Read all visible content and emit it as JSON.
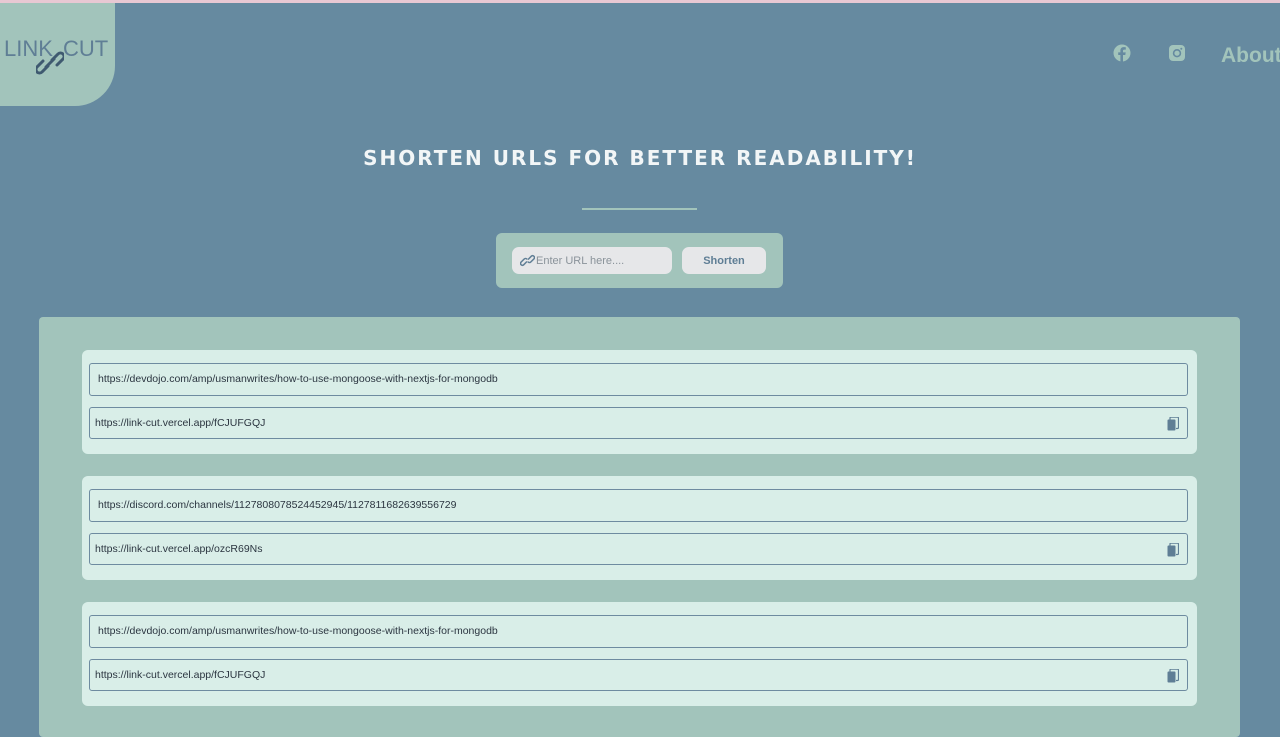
{
  "logo": {
    "left_text": "LINK",
    "right_text": "CUT"
  },
  "nav": {
    "facebook_icon": "facebook-icon",
    "instagram_icon": "instagram-icon",
    "about_label": "About"
  },
  "hero": {
    "headline": "SHORTEN URLS FOR BETTER READABILITY!"
  },
  "shortener": {
    "placeholder": "Enter URL here....",
    "input_value": "",
    "button_label": "Shorten"
  },
  "results": [
    {
      "original": "https://devdojo.com/amp/usmanwrites/how-to-use-mongoose-with-nextjs-for-mongodb",
      "short": "https://link-cut.vercel.app/fCJUFGQJ"
    },
    {
      "original": "https://discord.com/channels/1127808078524452945/1127811682639556729",
      "short": "https://link-cut.vercel.app/ozcR69Ns"
    },
    {
      "original": "https://devdojo.com/amp/usmanwrites/how-to-use-mongoose-with-nextjs-for-mongodb",
      "short": "https://link-cut.vercel.app/fCJUFGQJ"
    }
  ],
  "colors": {
    "background": "#668aa0",
    "accent": "#a2c4bb",
    "card": "#d9eee8",
    "top_strip": "#e8c8d3"
  }
}
